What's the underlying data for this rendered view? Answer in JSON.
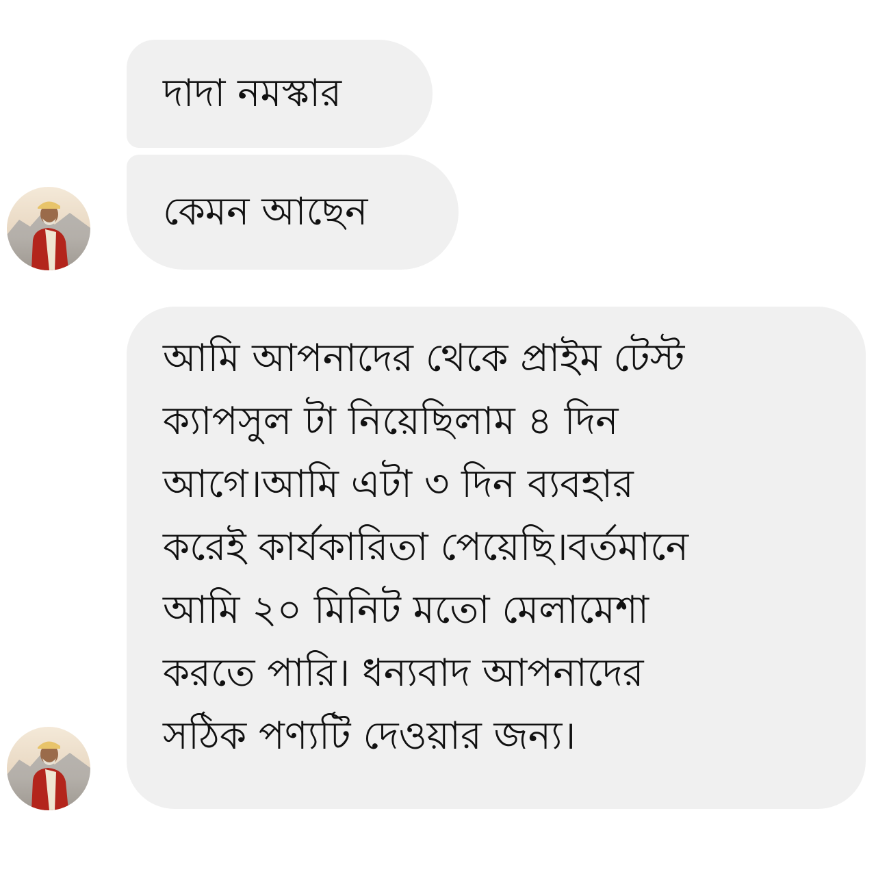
{
  "messages": [
    {
      "text": "দাদা নমস্কার"
    },
    {
      "text": "কেমন আছেন"
    },
    {
      "lines": [
        "আমি আপনাদের থেকে প্রাইম টেস্ট",
        "ক্যাপসুল টা নিয়েছিলাম ৪ দিন",
        "আগে।আমি এটা ৩ দিন ব্যবহার",
        "করেই কার্যকারিতা পেয়েছি।বর্তমানে",
        "আমি ২০ মিনিট মতো মেলামেশা",
        "করতে পারি। ধন্যবাদ আপনাদের",
        "সঠিক পণ্যটি দেওয়ার জন্য।"
      ]
    }
  ],
  "colors": {
    "bubble_bg": "#f0f0f0",
    "text": "#111111",
    "page_bg": "#ffffff"
  },
  "avatar": {
    "icon": "user-avatar-photo"
  }
}
